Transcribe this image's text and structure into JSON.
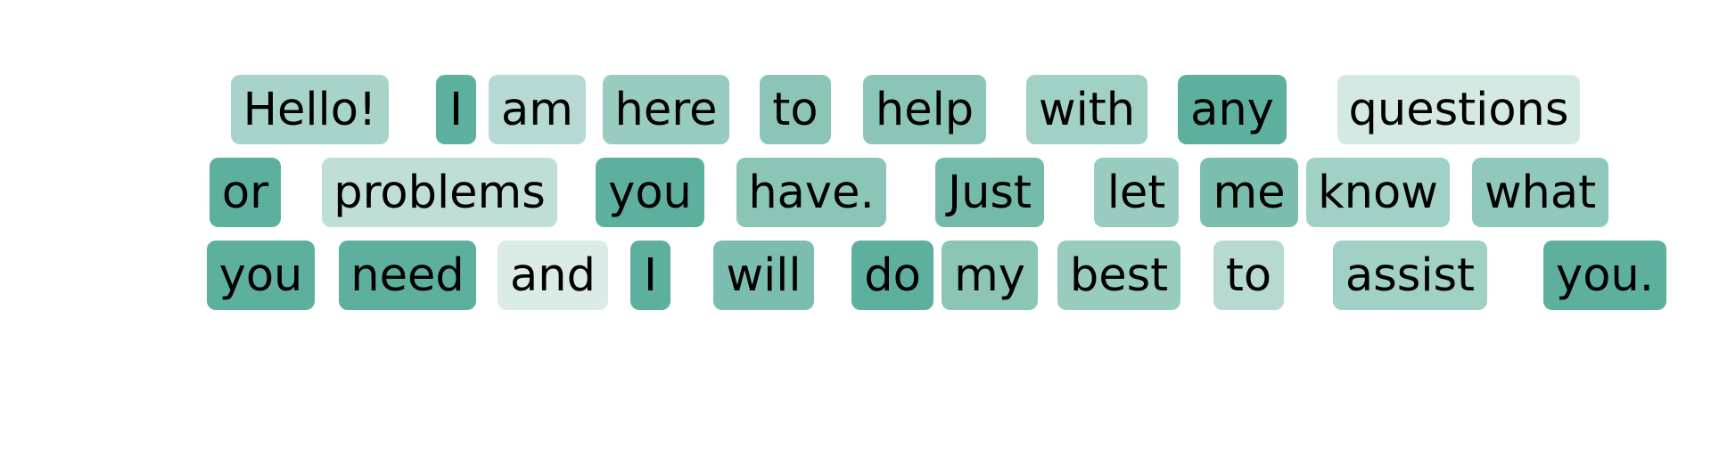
{
  "chart_data": {
    "type": "heatmap",
    "description_free": true,
    "color_scale": {
      "low": "#eaf3f1",
      "high": "#56ac9a"
    },
    "rows": [
      {
        "tokens": [
          {
            "text": "Hello!",
            "weight": 0.45
          },
          {
            "text": "I",
            "weight": 0.95
          },
          {
            "text": "am",
            "weight": 0.35
          },
          {
            "text": "here",
            "weight": 0.55
          },
          {
            "text": "to",
            "weight": 0.65
          },
          {
            "text": "help",
            "weight": 0.65
          },
          {
            "text": "with",
            "weight": 0.5
          },
          {
            "text": "any",
            "weight": 0.95
          },
          {
            "text": "questions",
            "weight": 0.15
          }
        ]
      },
      {
        "tokens": [
          {
            "text": "or",
            "weight": 0.95
          },
          {
            "text": "problems",
            "weight": 0.3
          },
          {
            "text": "you",
            "weight": 0.95
          },
          {
            "text": "have.",
            "weight": 0.65
          },
          {
            "text": "Just",
            "weight": 0.8
          },
          {
            "text": "let",
            "weight": 0.55
          },
          {
            "text": "me",
            "weight": 0.75
          },
          {
            "text": "know",
            "weight": 0.5
          },
          {
            "text": "what",
            "weight": 0.6
          }
        ]
      },
      {
        "tokens": [
          {
            "text": "you",
            "weight": 0.95
          },
          {
            "text": "need",
            "weight": 0.95
          },
          {
            "text": "and",
            "weight": 0.1
          },
          {
            "text": "I",
            "weight": 0.95
          },
          {
            "text": "will",
            "weight": 0.75
          },
          {
            "text": "do",
            "weight": 0.95
          },
          {
            "text": "my",
            "weight": 0.65
          },
          {
            "text": "best",
            "weight": 0.55
          },
          {
            "text": "to",
            "weight": 0.35
          },
          {
            "text": "assist",
            "weight": 0.5
          },
          {
            "text": "you.",
            "weight": 0.95
          }
        ]
      }
    ]
  }
}
